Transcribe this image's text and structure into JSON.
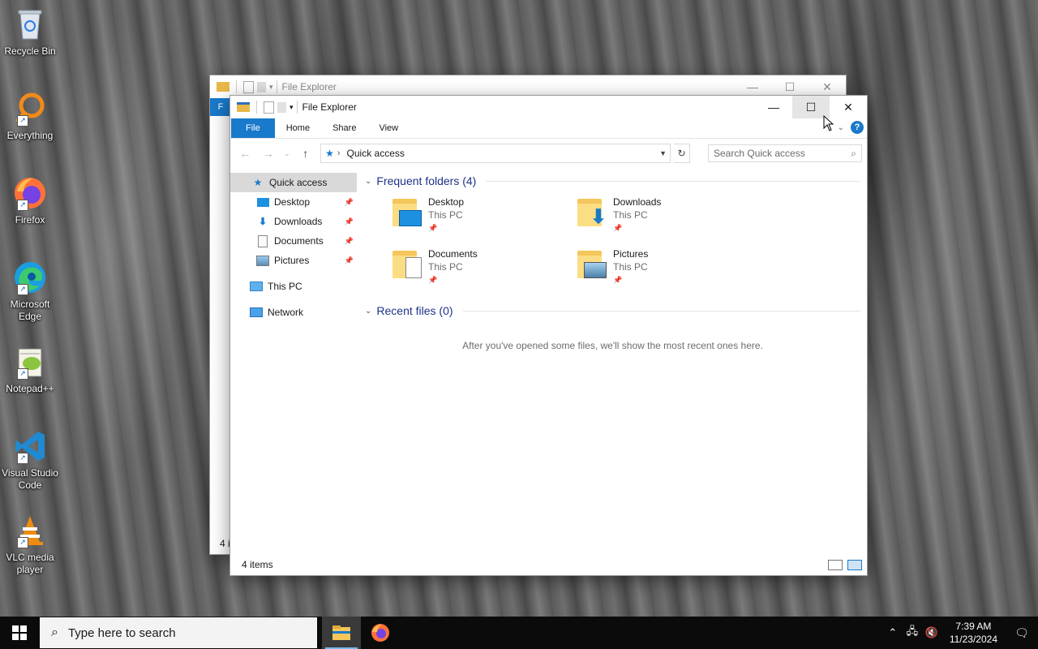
{
  "desktop": {
    "icons": [
      {
        "label": "Recycle Bin"
      },
      {
        "label": "Everything"
      },
      {
        "label": "Firefox"
      },
      {
        "label": "Microsoft Edge"
      },
      {
        "label": "Notepad++"
      },
      {
        "label": "Visual Studio Code"
      },
      {
        "label": "VLC media player"
      }
    ]
  },
  "back_window": {
    "title": "File Explorer",
    "file_tab": "F",
    "status": "4 i"
  },
  "window": {
    "title": "File Explorer",
    "tabs": {
      "file": "File",
      "home": "Home",
      "share": "Share",
      "view": "View"
    },
    "address": {
      "location": "Quick access"
    },
    "search": {
      "placeholder": "Search Quick access"
    },
    "nav": {
      "quick_access": "Quick access",
      "desktop": "Desktop",
      "downloads": "Downloads",
      "documents": "Documents",
      "pictures": "Pictures",
      "this_pc": "This PC",
      "network": "Network"
    },
    "frequent": {
      "header": "Frequent folders (4)",
      "items": [
        {
          "name": "Desktop",
          "location": "This PC"
        },
        {
          "name": "Downloads",
          "location": "This PC"
        },
        {
          "name": "Documents",
          "location": "This PC"
        },
        {
          "name": "Pictures",
          "location": "This PC"
        }
      ]
    },
    "recent": {
      "header": "Recent files (0)",
      "empty_message": "After you've opened some files, we'll show the most recent ones here."
    },
    "status": "4 items"
  },
  "taskbar": {
    "search_placeholder": "Type here to search",
    "time": "7:39 AM",
    "date": "11/23/2024"
  },
  "colors": {
    "accent": "#1979ca",
    "folder": "#f4c65b",
    "taskbar": "#0b0b0b"
  }
}
